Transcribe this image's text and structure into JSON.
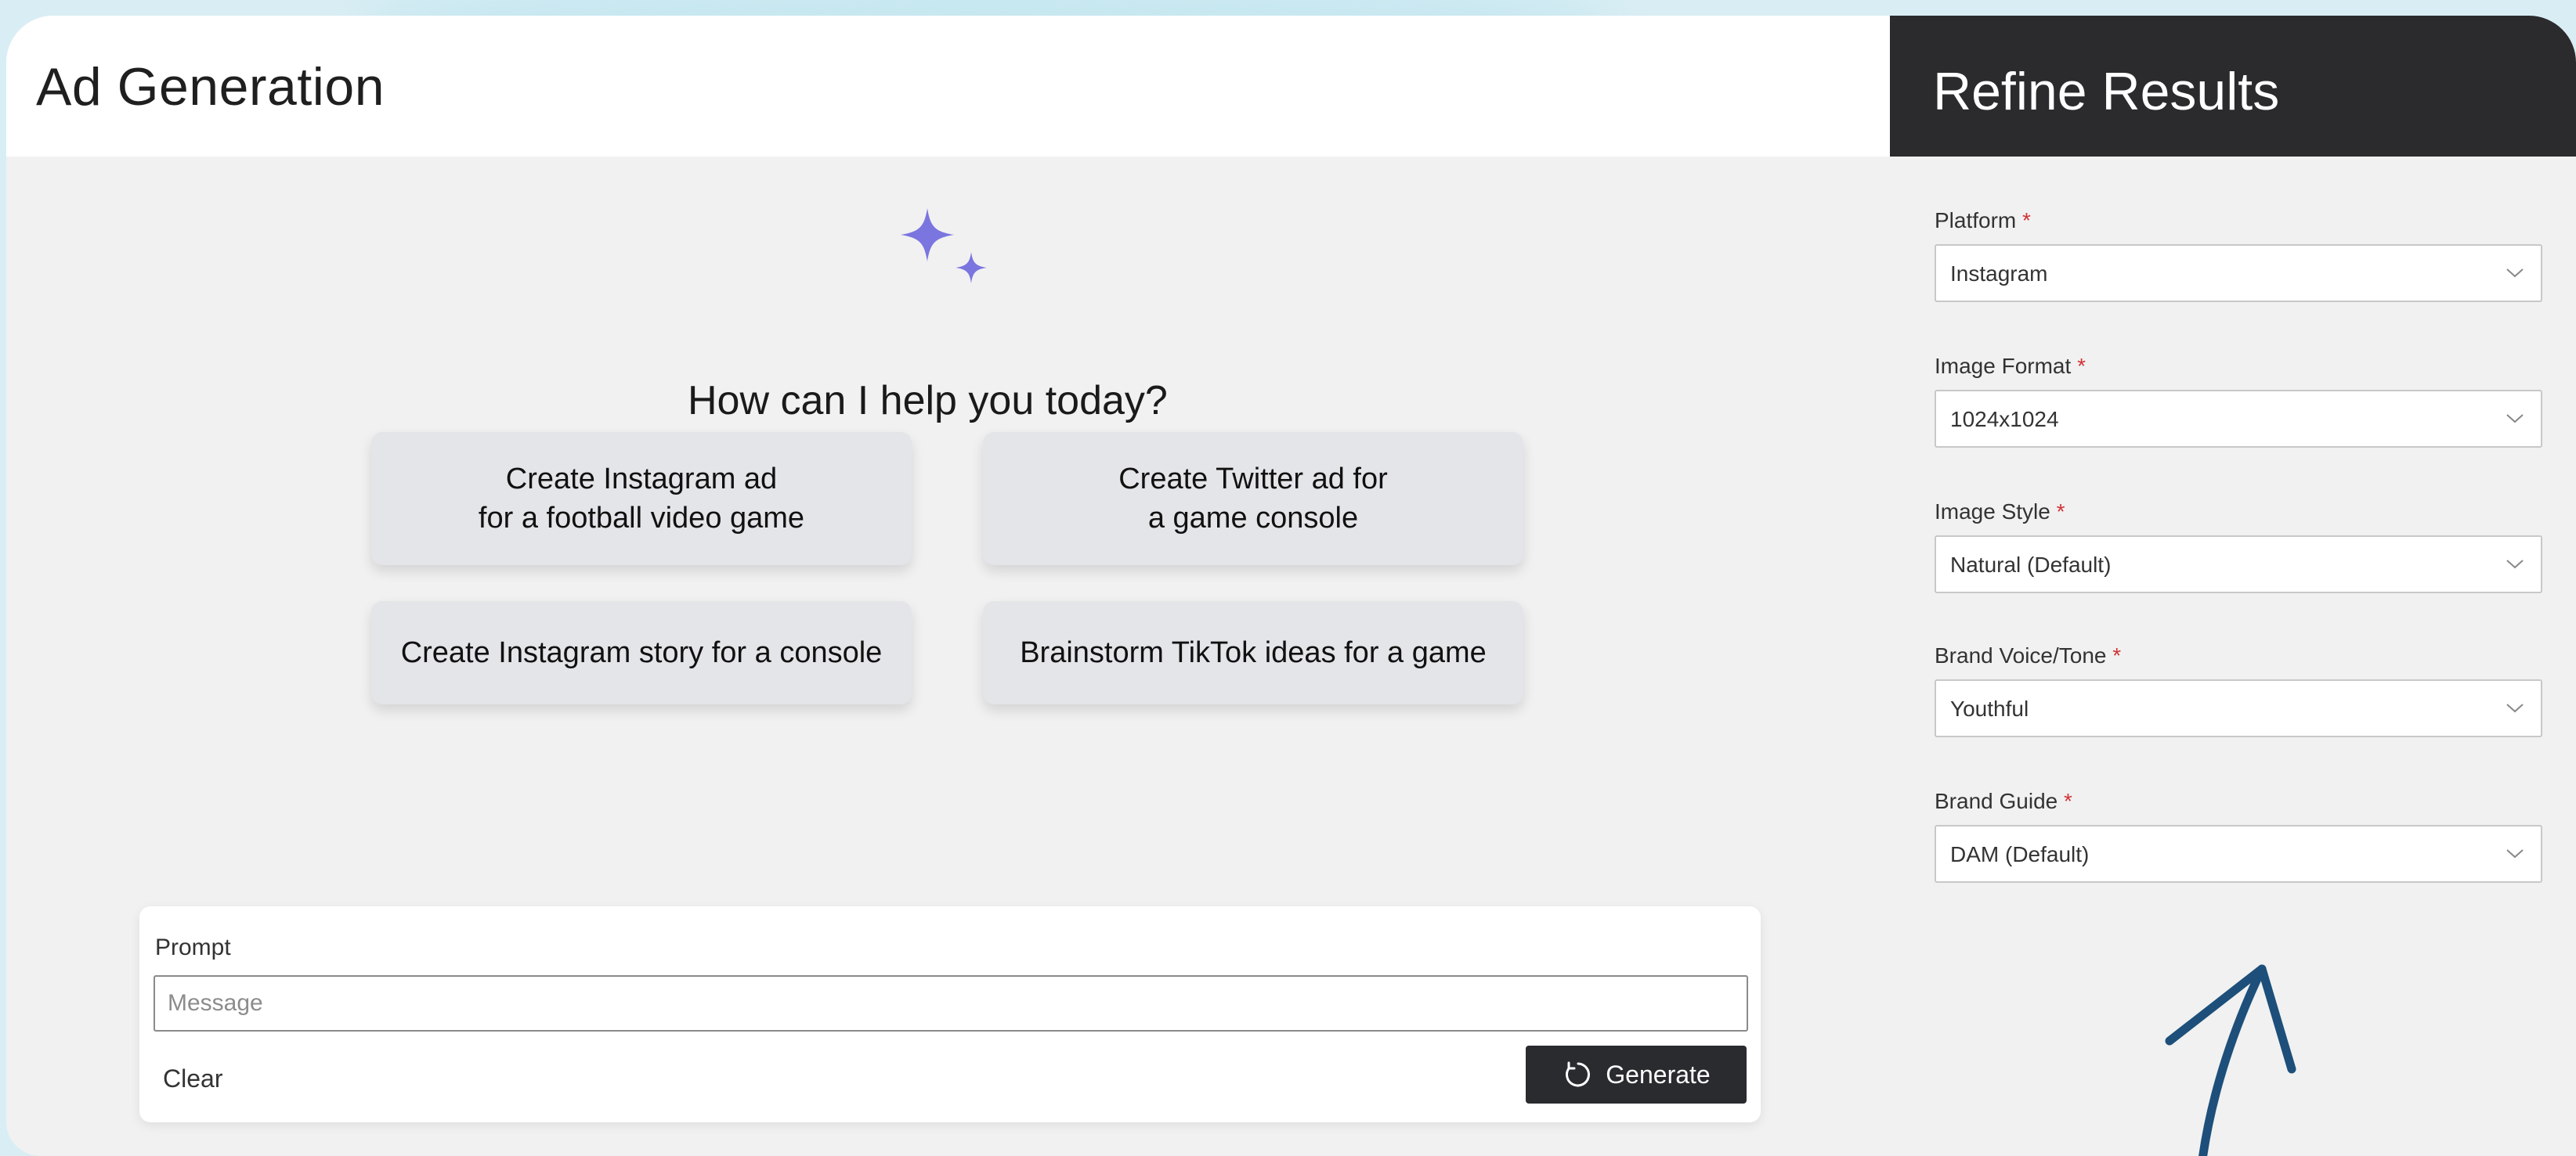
{
  "header": {
    "title": "Ad Generation"
  },
  "sidebar": {
    "title": "Refine Results",
    "required_marker": "*",
    "fields": [
      {
        "label": "Platform",
        "value": "Instagram"
      },
      {
        "label": "Image Format",
        "value": "1024x1024"
      },
      {
        "label": "Image Style",
        "value": "Natural (Default)"
      },
      {
        "label": "Brand Voice/Tone",
        "value": "Youthful"
      },
      {
        "label": "Brand Guide",
        "value": "DAM (Default)"
      }
    ]
  },
  "main": {
    "icon": "sparkle-icon",
    "greeting": "How can I help you today?",
    "suggestions": [
      "Create Instagram ad\nfor a football video game",
      "Create Twitter ad for\na game console",
      "Create Instagram story for a console",
      "Brainstorm TikTok ideas for a game"
    ]
  },
  "prompt": {
    "label": "Prompt",
    "placeholder": "Message",
    "value": "",
    "clear_label": "Clear",
    "generate_label": "Generate"
  },
  "colors": {
    "accent": "#7b75e0",
    "sidebar_header": "#2b2b2d",
    "required": "#d13438",
    "arrow": "#1d4f7a"
  }
}
